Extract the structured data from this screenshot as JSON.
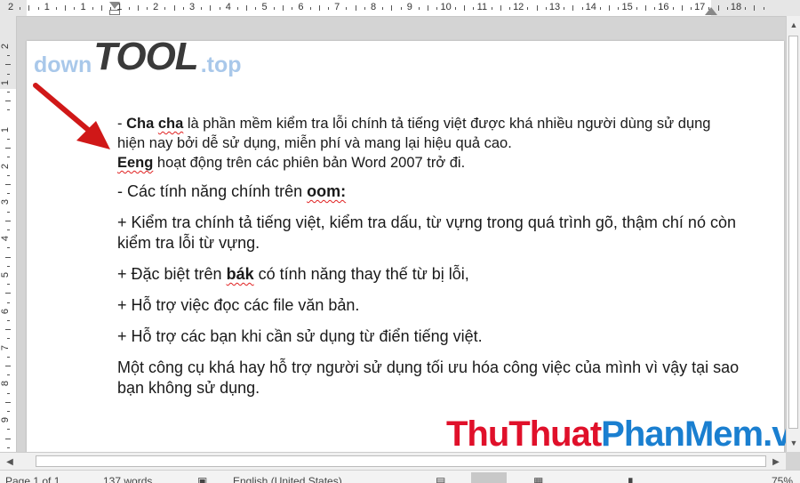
{
  "ruler": {
    "h_numbers": [
      "2",
      "1",
      "1",
      "1",
      "2",
      "3",
      "4",
      "5",
      "6",
      "7",
      "8",
      "9",
      "10",
      "11",
      "12",
      "13",
      "14",
      "15",
      "16",
      "17",
      "18"
    ],
    "v_numbers": [
      "2",
      "1",
      "1",
      "2",
      "3",
      "4",
      "5",
      "6",
      "7",
      "8",
      "9"
    ]
  },
  "logo": {
    "part1": "down",
    "part2": "TOOL",
    "part3": ".top"
  },
  "document": {
    "p1": {
      "dash": "- ",
      "word1": "Cha",
      "space": " ",
      "word2": "cha",
      "rest1": " là phần mềm kiểm tra lỗi chính tả tiếng việt được khá nhiều người dùng sử dụng hiện nay bởi dễ sử dụng, miễn phí và mang lại hiệu quả cao.",
      "word3": "Eeng",
      "rest2": "  hoạt động trên các phiên bản Word 2007 trở đi."
    },
    "p2": {
      "text": "- Các tính năng chính trên ",
      "word": "oom:"
    },
    "p3": "+ Kiểm tra chính tả tiếng việt, kiểm tra dấu, từ vựng trong quá trình gõ, thậm chí nó còn kiểm tra lỗi từ vựng.",
    "p4": {
      "text1": "+ Đặc biệt trên ",
      "word": "bák",
      "text2": " có tính năng thay thế từ bị lỗi,"
    },
    "p5": "+ Hỗ trợ việc đọc các file văn bản.",
    "p6": "+ Hỗ trợ các bạn khi cần sử dụng từ điển tiếng việt.",
    "p7": "Một công cụ  khá hay hỗ trợ người sử dụng tối ưu hóa công việc của mình vì vậy tại sao bạn không sử dụng."
  },
  "brand": {
    "part1": "ThuThuat",
    "part2": "PhanMem",
    "part3": ".vn"
  },
  "statusbar": {
    "page": "Page 1 of 1",
    "words": "137 words",
    "language": "English (United States)",
    "zoom": "75%"
  },
  "colors": {
    "arrow": "#d01818",
    "squiggle": "#e02020",
    "brand_red": "#e0102a",
    "brand_blue": "#1a7fd0",
    "logo_light": "#a9c8ea"
  }
}
